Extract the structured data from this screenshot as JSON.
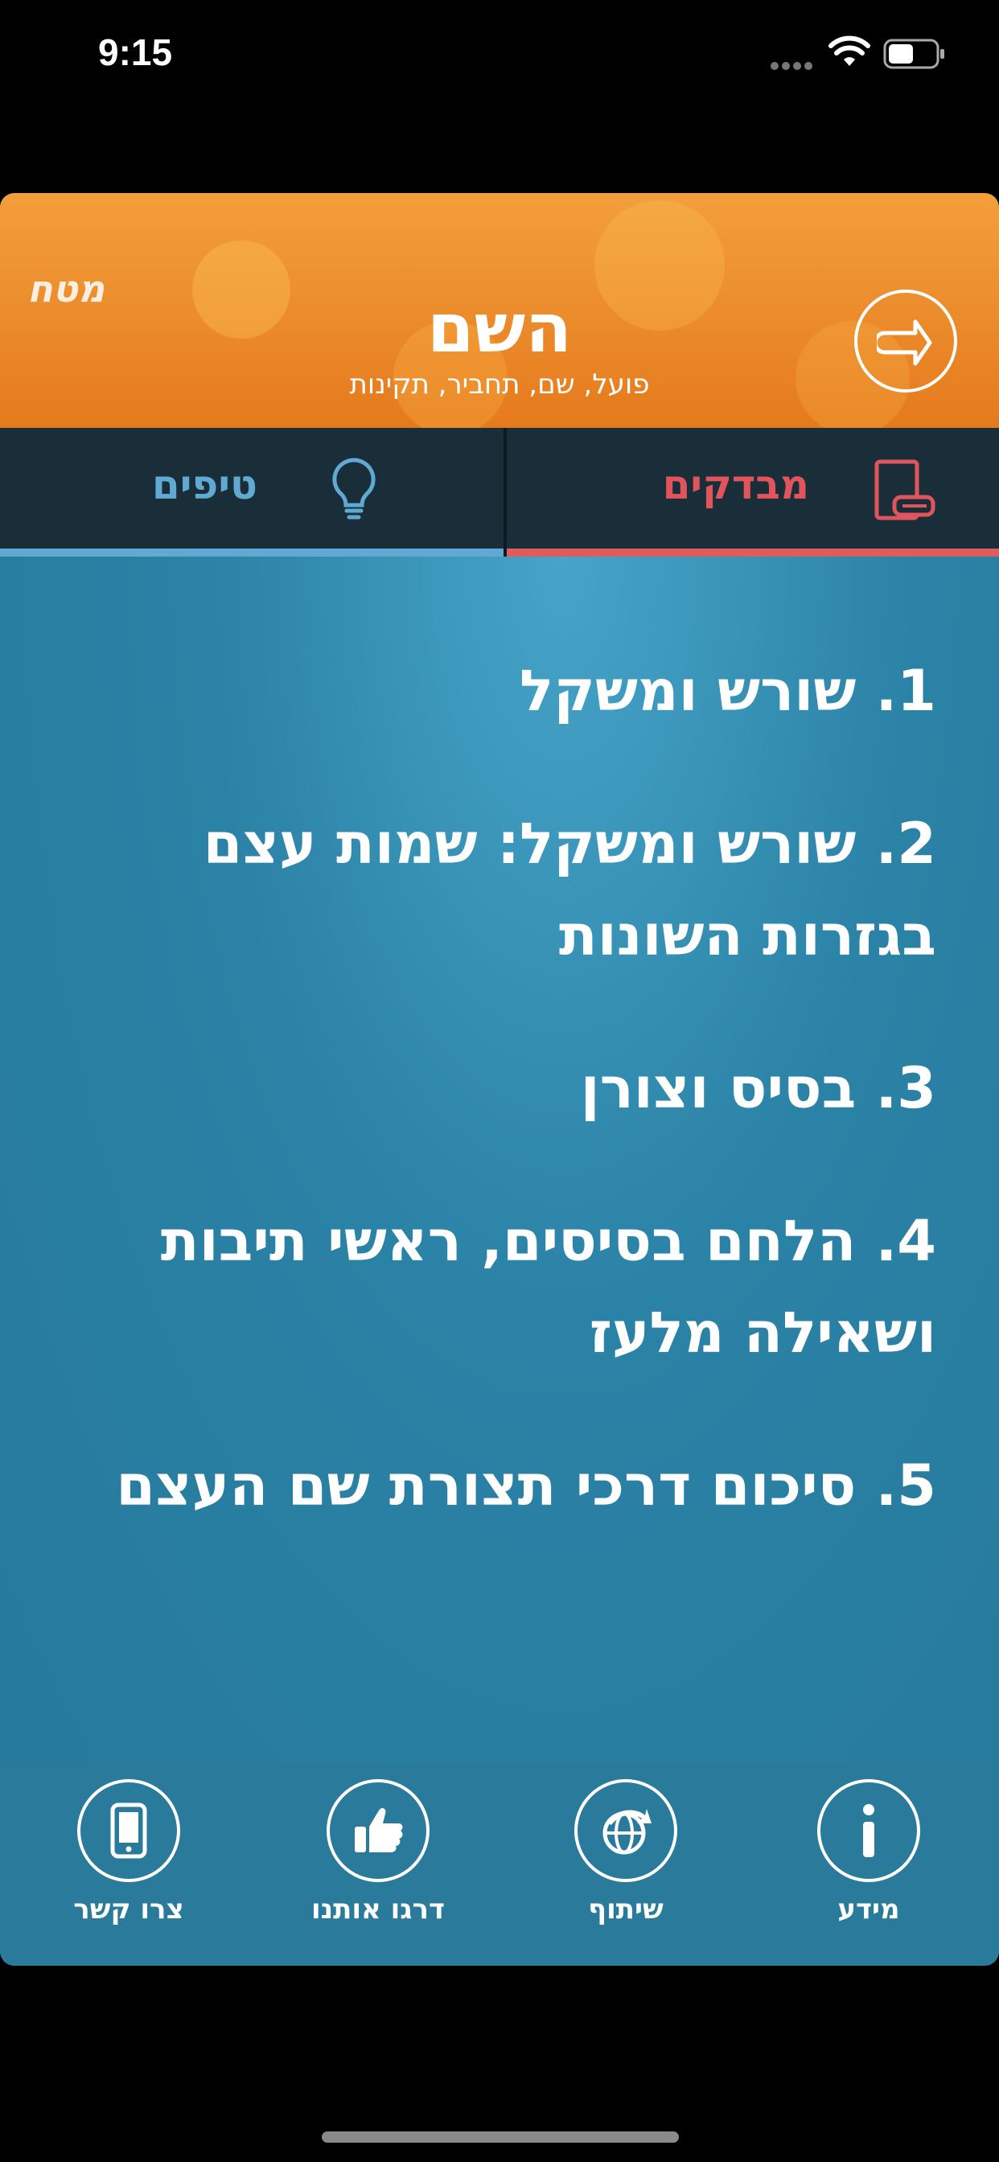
{
  "status_bar": {
    "time": "9:15"
  },
  "header": {
    "logo": "מטח",
    "title": "השם",
    "subtitle": "פועל, שם, תחביר, תקינות"
  },
  "tabs": [
    {
      "label": "טיפים",
      "accent": "#5fa9d2"
    },
    {
      "label": "מבדקים",
      "accent": "#e0555c"
    }
  ],
  "lessons": [
    "1. שורש ומשקל",
    "2. שורש ומשקל: שמות עצם בגזרות השונות",
    "3. בסיס וצורן",
    "4. הלחם בסיסים, ראשי תיבות ושאילה מלעז",
    "5. סיכום דרכי תצורת שם העצם"
  ],
  "bottom_bar": {
    "contact": "צרו קשר",
    "rate": "דרגו אותנו",
    "share": "שיתוף",
    "info": "מידע"
  },
  "colors": {
    "header": "#e9862a",
    "content": "#2a7b9b",
    "tab_bar": "#1a2e3a"
  }
}
